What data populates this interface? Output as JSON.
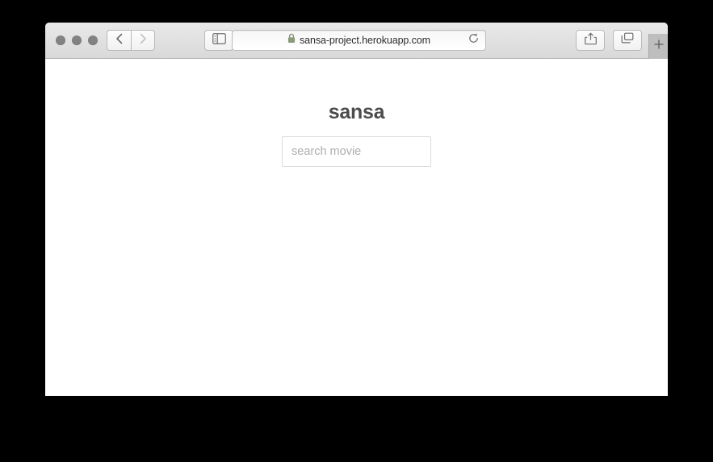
{
  "browser": {
    "window_controls": {
      "close_label": "close",
      "minimize_label": "minimize",
      "zoom_label": "zoom"
    },
    "toolbar": {
      "back_label": "Back",
      "forward_label": "Forward",
      "sidebar_label": "Show Sidebar",
      "share_label": "Share",
      "show_tabs_label": "Show Tab Overview",
      "new_tab_label": "+",
      "reload_label": "Reload this page"
    },
    "address_bar": {
      "url": "sansa-project.herokuapp.com",
      "secure": true,
      "lock_icon": "lock-icon",
      "reload_icon": "reload-icon"
    },
    "icons": {
      "back_icon": "chevron-left-icon",
      "forward_icon": "chevron-right-icon",
      "sidebar_icon": "sidebar-icon",
      "share_icon": "share-icon",
      "tabs_icon": "tab-overview-icon",
      "new_tab_icon": "plus-icon"
    }
  },
  "page": {
    "title": "sansa",
    "search": {
      "placeholder": "search movie",
      "value": ""
    }
  },
  "colors": {
    "page_background": "#ffffff",
    "desktop_background": "#000000",
    "toolbar_top": "#e9e9e9",
    "toolbar_bottom": "#d9d9d9",
    "title_text": "#4c4c4c",
    "placeholder_text": "#aeaeae",
    "input_border": "#dcdcdc",
    "traffic_light": "#828282",
    "new_tab_strip": "#bebebe"
  }
}
